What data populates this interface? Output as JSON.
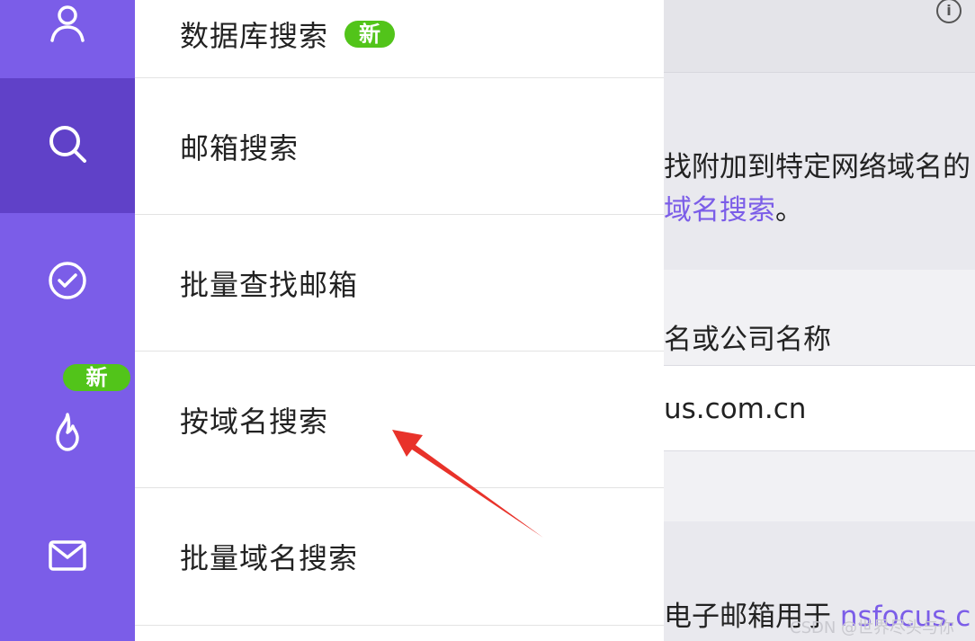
{
  "sidebar": {
    "items": [
      {
        "icon": "user-icon",
        "active": false
      },
      {
        "icon": "search-icon",
        "active": true
      },
      {
        "icon": "check-circle-icon",
        "active": false
      },
      {
        "icon": "fire-icon",
        "active": false,
        "badge": "新"
      },
      {
        "icon": "mail-icon",
        "active": false
      }
    ],
    "color": "#7b5de8",
    "active_color": "#6041c8"
  },
  "menu": {
    "items": [
      {
        "label": "数据库搜索",
        "badge": "新"
      },
      {
        "label": "邮箱搜索"
      },
      {
        "label": "批量查找邮箱"
      },
      {
        "label": "按域名搜索"
      },
      {
        "label": "批量域名搜索"
      }
    ]
  },
  "content": {
    "description_line1": "找附加到特定网络域名的",
    "description_link": "域名搜索",
    "description_end": "。",
    "form_label": "名或公司名称",
    "input_value": "us.com.cn",
    "bottom_text": "电子邮箱用于 ",
    "bottom_link": "nsfocus.c"
  },
  "watermark": "CSDN @世界尽头与你",
  "colors": {
    "accent": "#7b5de8",
    "badge_green": "#52c41a",
    "annotation_arrow": "#e8322a"
  }
}
